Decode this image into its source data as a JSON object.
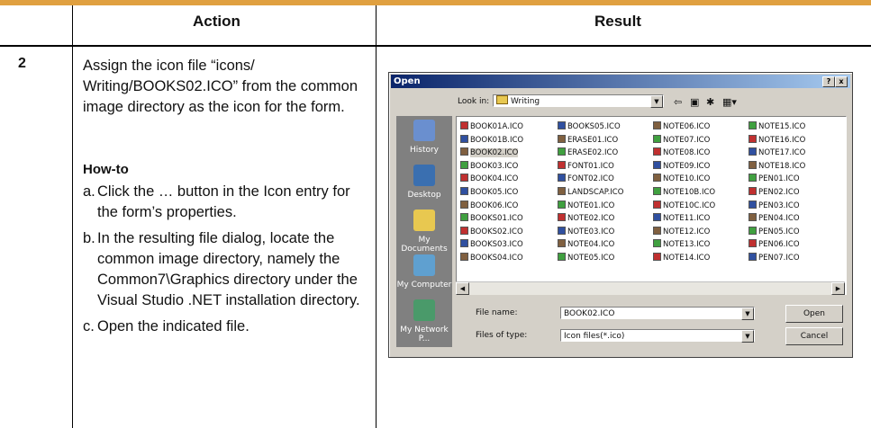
{
  "header": {
    "action": "Action",
    "result": "Result"
  },
  "step": {
    "number": "2",
    "text": "Assign the icon file “icons/ Writing/BOOKS02.ICO” from the common image directory as the icon for the form."
  },
  "howto": {
    "title": "How-to",
    "items": [
      {
        "label": "a.",
        "text": "Click the … button in the Icon entry for the form’s properties."
      },
      {
        "label": "b.",
        "text": "In the resulting file dialog, locate the common image directory, namely the Common7\\Graphics directory under the Visual Studio .NET installation directory."
      },
      {
        "label": "c.",
        "text": "Open the indicated file."
      }
    ]
  },
  "dialog": {
    "title": "Open",
    "lookin_label": "Look in:",
    "lookin_value": "Writing",
    "places": [
      "History",
      "Desktop",
      "My Documents",
      "My Computer",
      "My Network P..."
    ],
    "files": [
      [
        "BOOK01A.ICO",
        "BOOK01B.ICO",
        "BOOK02.ICO",
        "BOOK03.ICO",
        "BOOK04.ICO",
        "BOOK05.ICO",
        "BOOK06.ICO",
        "BOOKS01.ICO",
        "BOOKS02.ICO",
        "BOOKS03.ICO",
        "BOOKS04.ICO"
      ],
      [
        "BOOKS05.ICO",
        "ERASE01.ICO",
        "ERASE02.ICO",
        "FONT01.ICO",
        "FONT02.ICO",
        "LANDSCAP.ICO",
        "NOTE01.ICO",
        "NOTE02.ICO",
        "NOTE03.ICO",
        "NOTE04.ICO",
        "NOTE05.ICO"
      ],
      [
        "NOTE06.ICO",
        "NOTE07.ICO",
        "NOTE08.ICO",
        "NOTE09.ICO",
        "NOTE10.ICO",
        "NOTE10B.ICO",
        "NOTE10C.ICO",
        "NOTE11.ICO",
        "NOTE12.ICO",
        "NOTE13.ICO",
        "NOTE14.ICO"
      ],
      [
        "NOTE15.ICO",
        "NOTE16.ICO",
        "NOTE17.ICO",
        "NOTE18.ICO",
        "PEN01.ICO",
        "PEN02.ICO",
        "PEN03.ICO",
        "PEN04.ICO",
        "PEN05.ICO",
        "PEN06.ICO",
        "PEN07.ICO"
      ]
    ],
    "selected_file": "BOOK02.ICO",
    "filename_label": "File name:",
    "filename_value": "BOOK02.ICO",
    "filetype_label": "Files of type:",
    "filetype_value": "Icon files(*.ico)",
    "open_button": "Open",
    "cancel_button": "Cancel",
    "help_button": "?",
    "close_button": "x"
  }
}
